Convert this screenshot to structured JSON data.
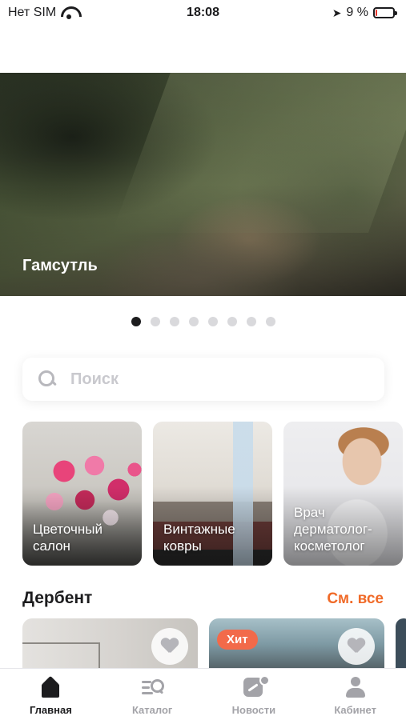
{
  "status_bar": {
    "carrier": "Нет SIM",
    "time": "18:08",
    "battery_percent": "9 %",
    "battery_level": 0.09,
    "icons": [
      "wifi-icon",
      "location-arrow-icon",
      "battery-charging-icon"
    ]
  },
  "hero": {
    "title": "Гамсутль",
    "slides_total": 8,
    "active_slide": 1
  },
  "search": {
    "placeholder": "Поиск",
    "value": "",
    "icon": "search-icon"
  },
  "categories": [
    {
      "label": "Цветочный\nсалон"
    },
    {
      "label": "Винтажные\nковры"
    },
    {
      "label": "Врач\nдерматолог-\nкосметолог"
    }
  ],
  "section": {
    "title": "Дербент",
    "see_all": "См. все"
  },
  "listings": [
    {
      "badge": "",
      "favorite": false
    },
    {
      "badge": "Хит",
      "favorite": false
    }
  ],
  "tab_bar": {
    "tabs": [
      {
        "label": "Главная",
        "icon": "home-icon",
        "active": true
      },
      {
        "label": "Каталог",
        "icon": "catalog-search-icon",
        "active": false
      },
      {
        "label": "Новости",
        "icon": "news-icon",
        "active": false
      },
      {
        "label": "Кабинет",
        "icon": "profile-icon",
        "active": false
      }
    ]
  },
  "colors": {
    "accent": "#f06a28",
    "badge": "#f26a4a",
    "tab_active": "#1c1c1e",
    "tab_inactive": "#a3a3a8"
  }
}
